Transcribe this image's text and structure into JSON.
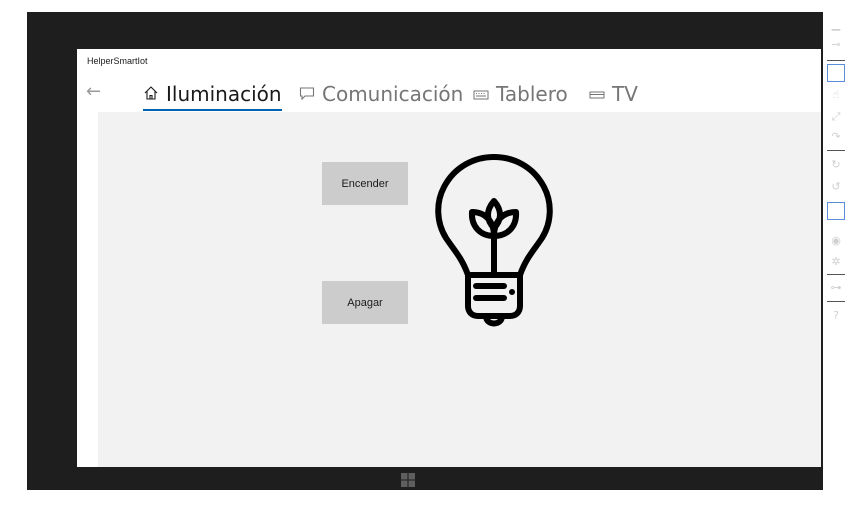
{
  "window": {
    "title": "HelperSmartIot"
  },
  "nav": {
    "back_icon": "back-arrow-icon",
    "tabs": [
      {
        "label": "Iluminación",
        "icon": "home-icon",
        "active": true
      },
      {
        "label": "Comunicación",
        "icon": "chat-icon",
        "active": false
      },
      {
        "label": "Tablero",
        "icon": "keyboard-icon",
        "active": false
      },
      {
        "label": "TV",
        "icon": "tv-icon",
        "active": false
      }
    ]
  },
  "controls": {
    "on_label": "Encender",
    "off_label": "Apagar"
  },
  "bulb": {
    "icon": "lightbulb-icon",
    "color": "#000000"
  },
  "colors": {
    "accent": "#0063b1",
    "button": "#cccccc",
    "content_bg": "#f2f2f2",
    "frame": "#1e1e1e"
  },
  "simulator_toolbar": {
    "tools": [
      "minimize-icon",
      "pin-icon",
      "mouse-pointer-icon",
      "touch-icon",
      "pinch-zoom-icon",
      "rotate-touch-icon",
      "rotate-clockwise-icon",
      "rotate-counterclockwise-icon",
      "resolution-icon",
      "screenshot-icon",
      "settings-icon",
      "network-icon",
      "help-icon"
    ],
    "help_label": "?"
  }
}
